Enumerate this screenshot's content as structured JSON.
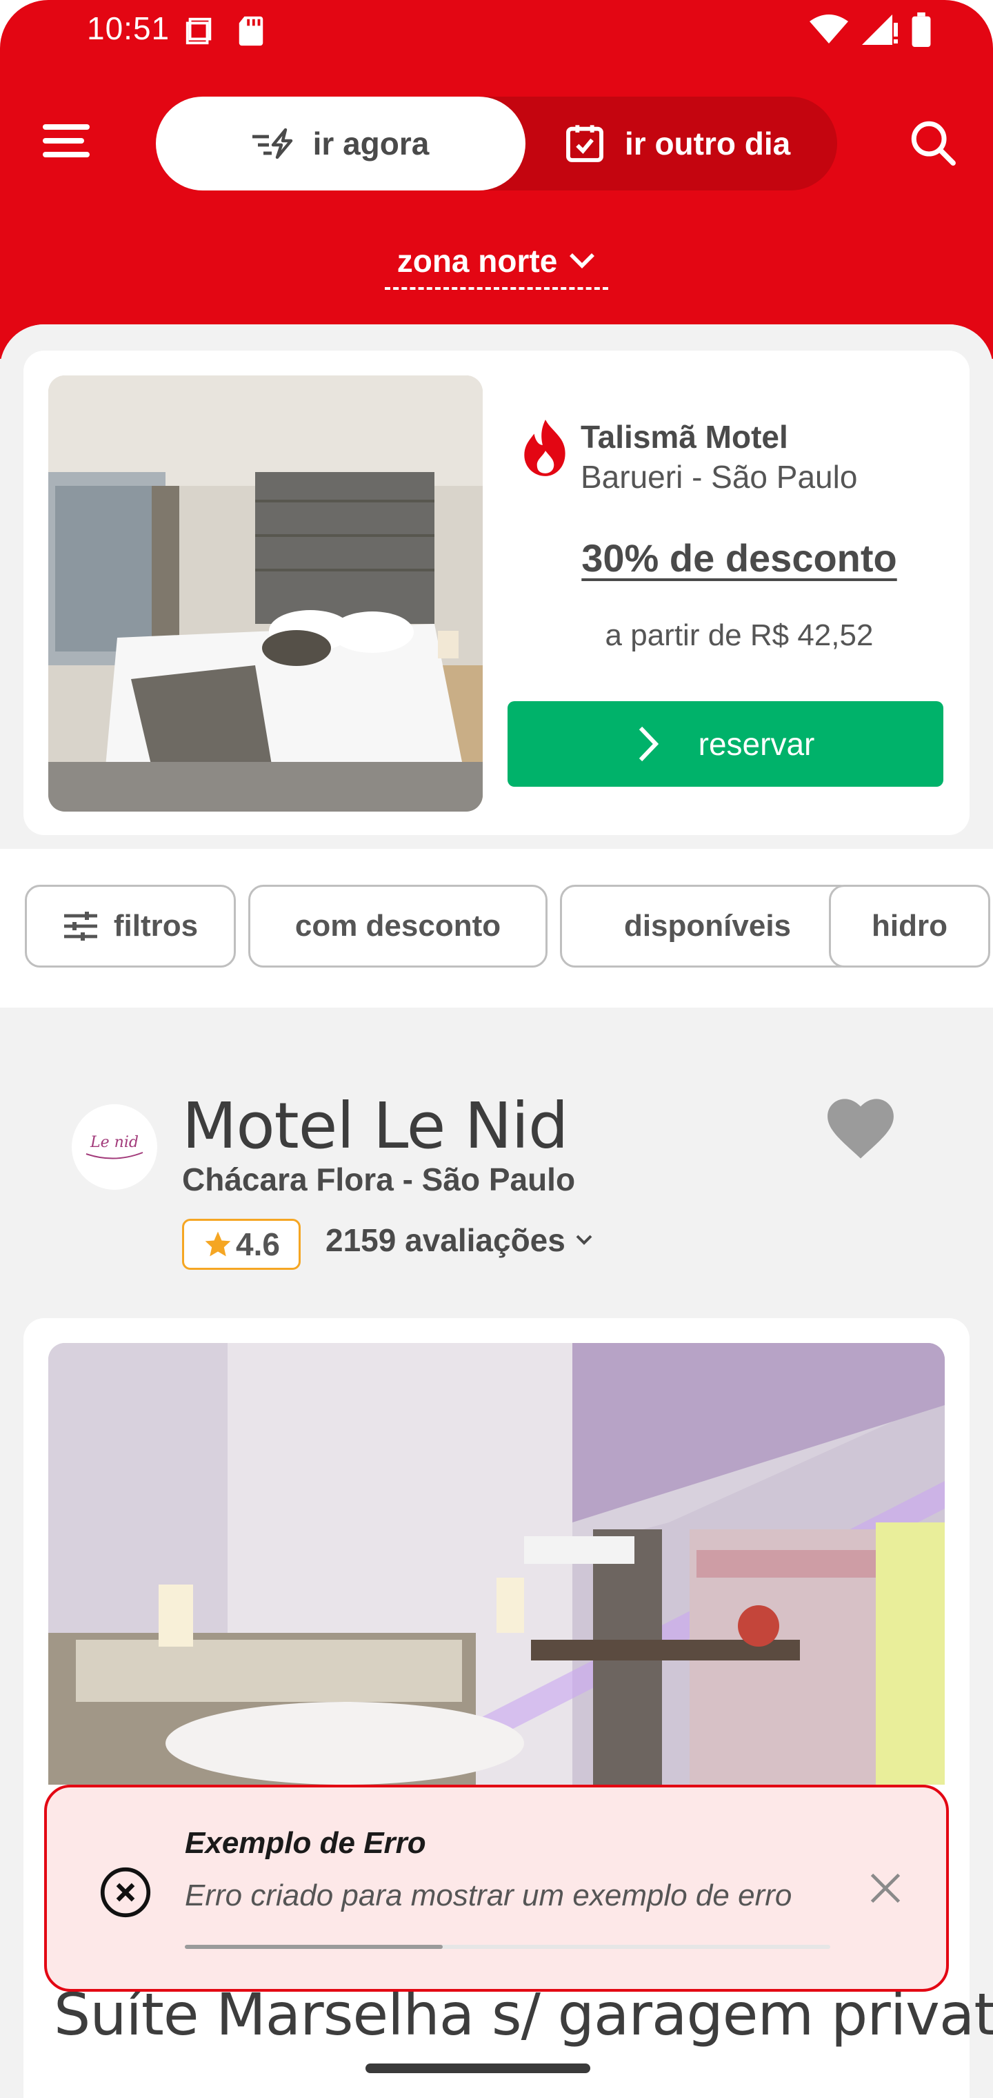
{
  "status_bar": {
    "time": "10:51"
  },
  "header": {
    "go_now_label": "ir agora",
    "go_other_day_label": "ir outro dia",
    "zone_label": "zona norte",
    "brand_color": "#e30613"
  },
  "promo": {
    "motel_name": "Talismã Motel",
    "location": "Barueri - São Paulo",
    "discount": "30% de desconto",
    "price": "a partir de R$ 42,52",
    "reserve_label": "reservar",
    "reserve_color": "#00b26a"
  },
  "filters": [
    {
      "label": "filtros"
    },
    {
      "label": "com desconto"
    },
    {
      "label": "disponíveis"
    },
    {
      "label": "hidro"
    }
  ],
  "hotel": {
    "name": "Motel Le Nid",
    "location": "Chácara Flora - São Paulo",
    "rating": "4.6",
    "reviews": "2159 avaliações",
    "logo_text": "Le nid"
  },
  "room": {
    "title": "Suíte Marselha s/ garagem privativa"
  },
  "toast": {
    "title": "Exemplo de Erro",
    "message": "Erro criado para mostrar um exemplo de erro",
    "progress": 0.4
  }
}
